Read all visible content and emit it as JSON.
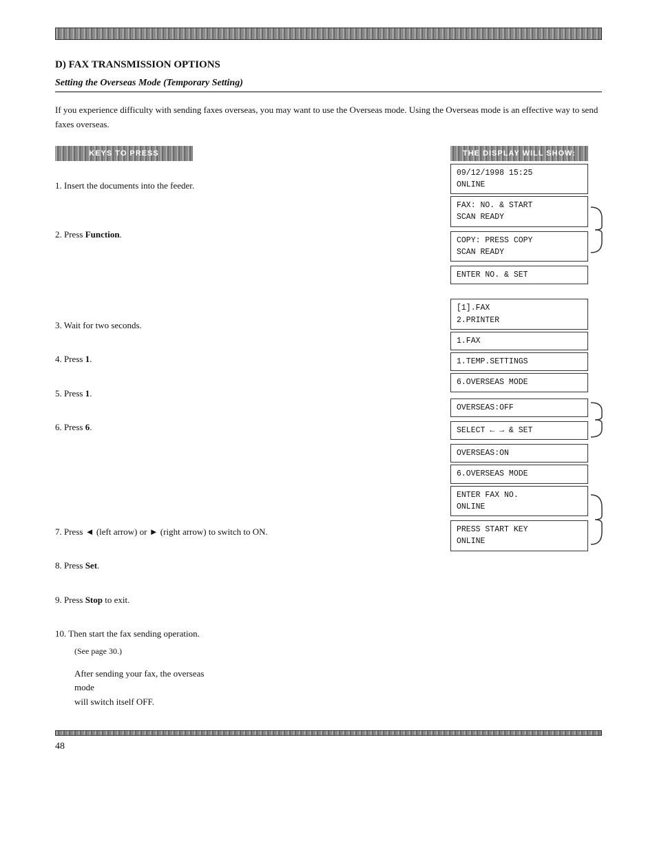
{
  "page": {
    "top_bar": true,
    "section_title": "D) FAX TRANSMISSION OPTIONS",
    "subtitle": "Setting the Overseas Mode (Temporary Setting)",
    "intro": "If you experience difficulty with sending faxes overseas, you may want to use the Overseas mode. Using the Overseas mode is an effective way to send faxes overseas.",
    "keys_header": "KEYS TO PRESS",
    "display_header": "THE DISPLAY WILL SHOW:",
    "steps": [
      {
        "num": "1.",
        "text": "Insert the documents into the feeder."
      },
      {
        "num": "2.",
        "text": "Press ",
        "bold": "Function",
        "after": "."
      },
      {
        "num": "3.",
        "text": "Wait for two seconds."
      },
      {
        "num": "4.",
        "text": "Press ",
        "bold": "1",
        "after": "."
      },
      {
        "num": "5.",
        "text": "Press ",
        "bold": "1",
        "after": "."
      },
      {
        "num": "6.",
        "text": "Press ",
        "bold": "6",
        "after": "."
      },
      {
        "num": "7.",
        "text": "Press ◄ (left arrow) or ► (right arrow) to switch to ON."
      },
      {
        "num": "8.",
        "text": "Press ",
        "bold": "Set",
        "after": "."
      },
      {
        "num": "9.",
        "text": "Press ",
        "bold": "Stop",
        "after": " to exit."
      },
      {
        "num": "10.",
        "text": "Then start the fax sending operation. (See page 30.)"
      }
    ],
    "displays": [
      {
        "id": "date",
        "line1": "09/12/1998 15:25",
        "line2": "ONLINE"
      },
      {
        "id": "fax-scan",
        "line1": "FAX: NO. & START",
        "line2": "SCAN READY",
        "brace_right": true
      },
      {
        "id": "copy-scan",
        "line1": "COPY: PRESS COPY",
        "line2": "SCAN READY",
        "brace_right": true
      },
      {
        "id": "enter-no",
        "line1": "ENTER NO. & SET",
        "line2": ""
      },
      {
        "id": "fax-printer",
        "line1": "[1].FAX",
        "line2": "2.PRINTER"
      },
      {
        "id": "fax",
        "line1": "1.FAX",
        "line2": ""
      },
      {
        "id": "temp-settings",
        "line1": "1.TEMP.SETTINGS",
        "line2": ""
      },
      {
        "id": "overseas-mode1",
        "line1": "6.OVERSEAS MODE",
        "line2": ""
      },
      {
        "id": "overseas-off",
        "line1": "OVERSEAS:OFF",
        "line2": ""
      },
      {
        "id": "select-set",
        "line1": "SELECT ← → & SET",
        "line2": ""
      },
      {
        "id": "overseas-on",
        "line1": "OVERSEAS:ON",
        "line2": ""
      },
      {
        "id": "overseas-mode2",
        "line1": "6.OVERSEAS MODE",
        "line2": ""
      },
      {
        "id": "enter-fax",
        "line1": "ENTER FAX NO.",
        "line2": "ONLINE",
        "brace_right": true
      },
      {
        "id": "press-start",
        "line1": "PRESS START KEY",
        "line2": "ONLINE",
        "brace_right": true
      }
    ],
    "after_text_line1": "After sending your fax, the overseas mode",
    "after_text_line2": "will switch itself OFF.",
    "bottom_bar": true,
    "page_number": "48"
  }
}
